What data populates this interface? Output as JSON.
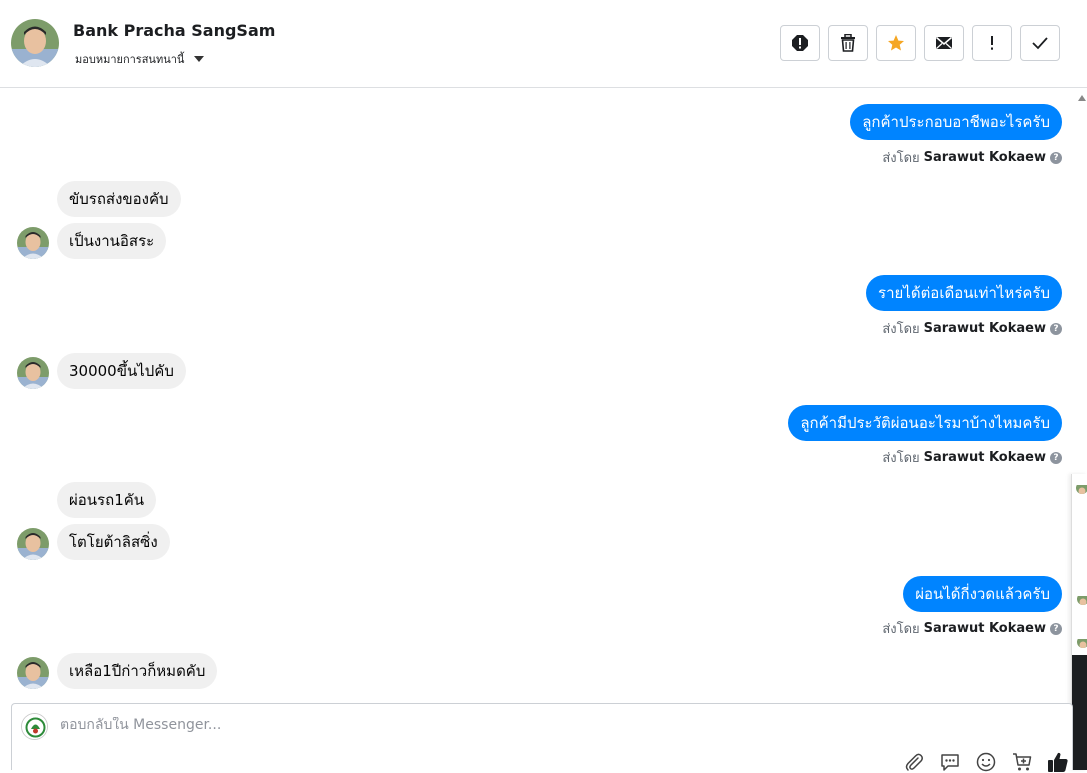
{
  "header": {
    "contact_name": "Bank Pracha SangSam",
    "assign_label": "มอบหมายการสนทนานี้",
    "action_icons": [
      "spam-icon",
      "trash-icon",
      "star-icon",
      "envelope-icon",
      "exclamation-icon",
      "check-icon"
    ],
    "star_color": "#f5a623"
  },
  "thread": {
    "sent_by_prefix": "ส่งโดย",
    "messages": [
      {
        "from": "page",
        "text": "ลูกค้าประกอบอาชีพอะไรครับ",
        "sender": "Sarawut Kokaew"
      },
      {
        "from": "customer",
        "text": "ขับรถส่งของคับ"
      },
      {
        "from": "customer",
        "text": "เป็นงานอิสระ"
      },
      {
        "from": "page",
        "text": "รายได้ต่อเดือนเท่าไหร่ครับ",
        "sender": "Sarawut Kokaew"
      },
      {
        "from": "customer",
        "text": "30000ขึ้นไปคับ"
      },
      {
        "from": "page",
        "text": "ลูกค้ามีประวัติผ่อนอะไรมาบ้างไหมครับ",
        "sender": "Sarawut Kokaew"
      },
      {
        "from": "customer",
        "text": "ผ่อนรถ1คัน"
      },
      {
        "from": "customer",
        "text": "โตโยต้าลิสซิ่ง"
      },
      {
        "from": "page",
        "text": "ผ่อนได้กี่งวดแล้วครับ",
        "sender": "Sarawut Kokaew"
      },
      {
        "from": "customer",
        "text": "เหลือ1ปีก่าวก็หมดคับ"
      }
    ]
  },
  "composer": {
    "placeholder": "ตอบกลับใน Messenger...",
    "tool_icons": [
      "paperclip-icon",
      "saved-reply-icon",
      "emoji-icon",
      "cart-icon",
      "thumbs-up-icon"
    ]
  },
  "colors": {
    "outgoing_bubble": "#0084ff",
    "incoming_bubble": "#f0f0f0"
  }
}
